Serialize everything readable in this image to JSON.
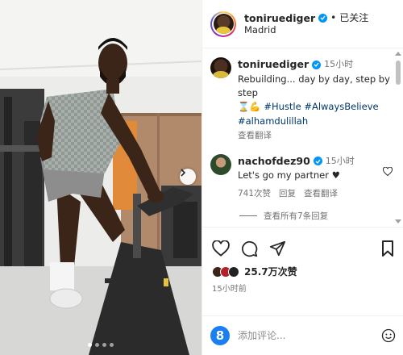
{
  "post": {
    "username": "toniruediger",
    "separator": "•",
    "follow_state": "已关注",
    "location": "Madrid"
  },
  "caption": {
    "username": "toniruediger",
    "time": "15小时",
    "text_line1": "Rebuilding... day by day, step by step",
    "emoji_icons": [
      "hourglass-icon",
      "flexed-biceps-icon"
    ],
    "hashtags": [
      "#Hustle",
      "#AlwaysBelieve",
      "#alhamdulillah"
    ],
    "translate": "查看翻译"
  },
  "comments": [
    {
      "username": "nachofdez90",
      "time": "15小时",
      "text": "Let's go my partner",
      "emoji_icon": "black-heart-icon",
      "likes": "741次赞",
      "reply": "回复",
      "translate": "查看翻译",
      "view_replies": "查看所有7条回复"
    }
  ],
  "stats": {
    "likes": "25.7万次赞",
    "time": "15小时前"
  },
  "composer": {
    "avatar_letter": "8",
    "placeholder": "添加评论..."
  },
  "carousel": {
    "count": 4,
    "active_index": 0
  },
  "colors": {
    "link": "#00376b",
    "verified": "#0095f6",
    "muted": "#737373"
  }
}
